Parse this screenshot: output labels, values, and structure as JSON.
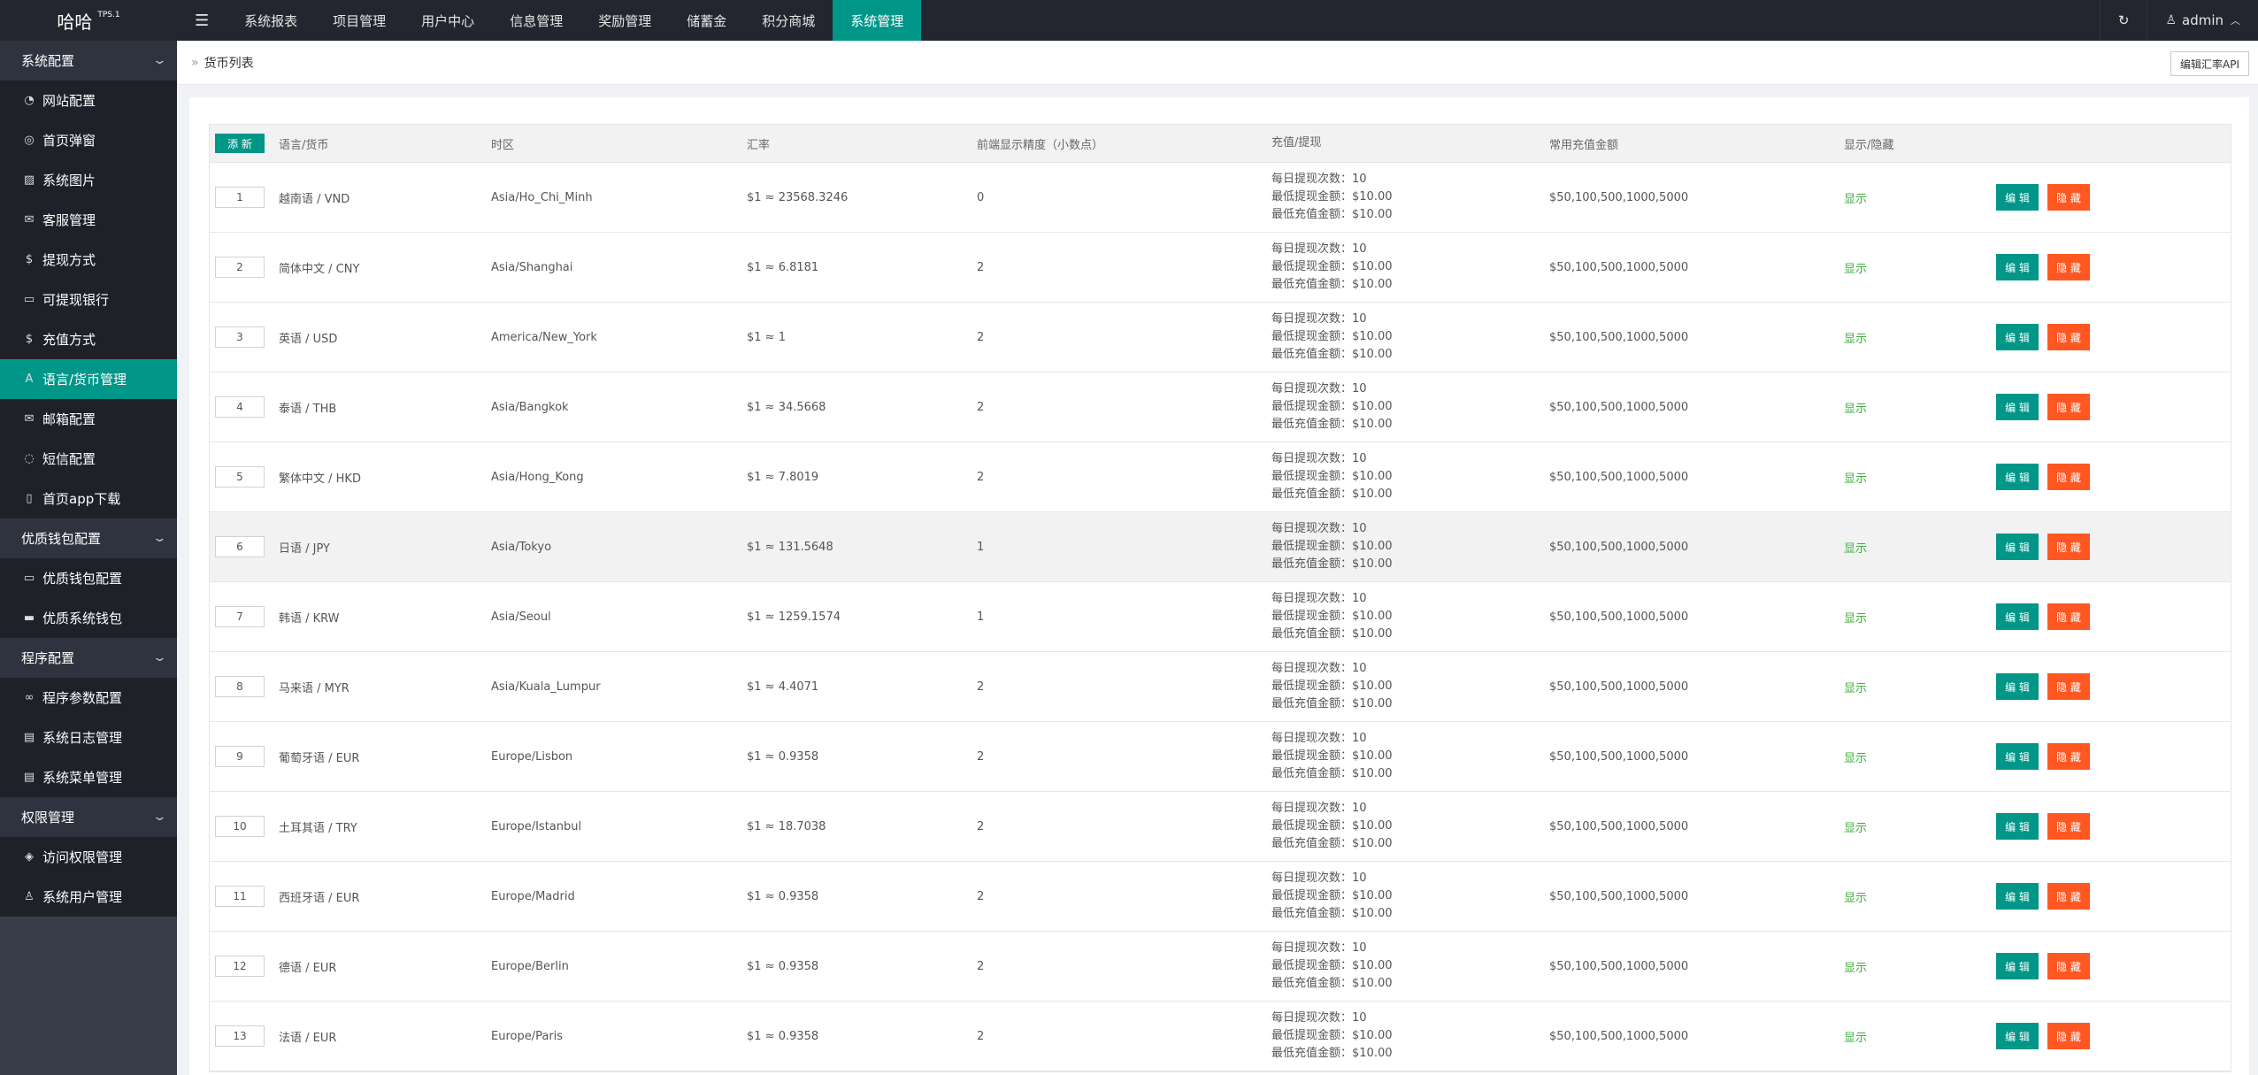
{
  "app": {
    "logo": "哈哈",
    "version": "TPS.1"
  },
  "topnav": {
    "menu_icon": "☰",
    "items": [
      "系统报表",
      "项目管理",
      "用户中心",
      "信息管理",
      "奖励管理",
      "储蓄金",
      "积分商城",
      "系统管理"
    ],
    "active_index": 7,
    "refresh_icon": "↻",
    "user": "admin"
  },
  "sidebar": [
    {
      "type": "group",
      "label": "系统配置"
    },
    {
      "type": "item",
      "icon": "◔",
      "label": "网站配置"
    },
    {
      "type": "item",
      "icon": "◎",
      "label": "首页弹窗"
    },
    {
      "type": "item",
      "icon": "▨",
      "label": "系统图片"
    },
    {
      "type": "item",
      "icon": "✉",
      "label": "客服管理"
    },
    {
      "type": "item",
      "icon": "$",
      "label": "提现方式"
    },
    {
      "type": "item",
      "icon": "▭",
      "label": "可提现银行"
    },
    {
      "type": "item",
      "icon": "$",
      "label": "充值方式"
    },
    {
      "type": "item",
      "icon": "A",
      "label": "语言/货币管理",
      "active": true
    },
    {
      "type": "item",
      "icon": "✉",
      "label": "邮箱配置"
    },
    {
      "type": "item",
      "icon": "◌",
      "label": "短信配置"
    },
    {
      "type": "item",
      "icon": "▯",
      "label": "首页app下载"
    },
    {
      "type": "group",
      "label": "优质钱包配置"
    },
    {
      "type": "item",
      "icon": "▭",
      "label": "优质钱包配置"
    },
    {
      "type": "item",
      "icon": "▬",
      "label": "优质系统钱包"
    },
    {
      "type": "group",
      "label": "程序配置"
    },
    {
      "type": "item",
      "icon": "∞",
      "label": "程序参数配置"
    },
    {
      "type": "item",
      "icon": "▤",
      "label": "系统日志管理"
    },
    {
      "type": "item",
      "icon": "▤",
      "label": "系统菜单管理"
    },
    {
      "type": "group",
      "label": "权限管理"
    },
    {
      "type": "item",
      "icon": "◈",
      "label": "访问权限管理"
    },
    {
      "type": "item",
      "icon": "♙",
      "label": "系统用户管理"
    }
  ],
  "breadcrumb": {
    "sep": "»",
    "title": "货币列表"
  },
  "api_button": "编辑汇率API",
  "table": {
    "new_button": "添 新",
    "headers": [
      "语言/货币",
      "时区",
      "汇率",
      "前端显示精度（小数点）",
      "充值/提现",
      "常用充值金额",
      "显示/隐藏"
    ],
    "edit_label": "编 辑",
    "hide_label": "隐 藏",
    "rows": [
      {
        "no": "1",
        "lang": "越南语 / VND",
        "tz": "Asia/Ho_Chi_Minh",
        "rate": "$1 ≈ 23568.3246",
        "precision": "0",
        "limits": [
          "每日提现次数：10",
          "最低提现金额：$10.00",
          "最低充值金额：$10.00"
        ],
        "amounts": "$50,100,500,1000,5000",
        "status": "显示"
      },
      {
        "no": "2",
        "lang": "简体中文 / CNY",
        "tz": "Asia/Shanghai",
        "rate": "$1 ≈ 6.8181",
        "precision": "2",
        "limits": [
          "每日提现次数：10",
          "最低提现金额：$10.00",
          "最低充值金额：$10.00"
        ],
        "amounts": "$50,100,500,1000,5000",
        "status": "显示"
      },
      {
        "no": "3",
        "lang": "英语 / USD",
        "tz": "America/New_York",
        "rate": "$1 ≈ 1",
        "precision": "2",
        "limits": [
          "每日提现次数：10",
          "最低提现金额：$10.00",
          "最低充值金额：$10.00"
        ],
        "amounts": "$50,100,500,1000,5000",
        "status": "显示"
      },
      {
        "no": "4",
        "lang": "泰语 / THB",
        "tz": "Asia/Bangkok",
        "rate": "$1 ≈ 34.5668",
        "precision": "2",
        "limits": [
          "每日提现次数：10",
          "最低提现金额：$10.00",
          "最低充值金额：$10.00"
        ],
        "amounts": "$50,100,500,1000,5000",
        "status": "显示"
      },
      {
        "no": "5",
        "lang": "繁体中文 / HKD",
        "tz": "Asia/Hong_Kong",
        "rate": "$1 ≈ 7.8019",
        "precision": "2",
        "limits": [
          "每日提现次数：10",
          "最低提现金额：$10.00",
          "最低充值金额：$10.00"
        ],
        "amounts": "$50,100,500,1000,5000",
        "status": "显示"
      },
      {
        "no": "6",
        "lang": "日语 / JPY",
        "tz": "Asia/Tokyo",
        "rate": "$1 ≈ 131.5648",
        "precision": "1",
        "limits": [
          "每日提现次数：10",
          "最低提现金额：$10.00",
          "最低充值金额：$10.00"
        ],
        "amounts": "$50,100,500,1000,5000",
        "status": "显示",
        "hover": true
      },
      {
        "no": "7",
        "lang": "韩语 / KRW",
        "tz": "Asia/Seoul",
        "rate": "$1 ≈ 1259.1574",
        "precision": "1",
        "limits": [
          "每日提现次数：10",
          "最低提现金额：$10.00",
          "最低充值金额：$10.00"
        ],
        "amounts": "$50,100,500,1000,5000",
        "status": "显示"
      },
      {
        "no": "8",
        "lang": "马来语 / MYR",
        "tz": "Asia/Kuala_Lumpur",
        "rate": "$1 ≈ 4.4071",
        "precision": "2",
        "limits": [
          "每日提现次数：10",
          "最低提现金额：$10.00",
          "最低充值金额：$10.00"
        ],
        "amounts": "$50,100,500,1000,5000",
        "status": "显示"
      },
      {
        "no": "9",
        "lang": "葡萄牙语 / EUR",
        "tz": "Europe/Lisbon",
        "rate": "$1 ≈ 0.9358",
        "precision": "2",
        "limits": [
          "每日提现次数：10",
          "最低提现金额：$10.00",
          "最低充值金额：$10.00"
        ],
        "amounts": "$50,100,500,1000,5000",
        "status": "显示"
      },
      {
        "no": "10",
        "lang": "土耳其语 / TRY",
        "tz": "Europe/Istanbul",
        "rate": "$1 ≈ 18.7038",
        "precision": "2",
        "limits": [
          "每日提现次数：10",
          "最低提现金额：$10.00",
          "最低充值金额：$10.00"
        ],
        "amounts": "$50,100,500,1000,5000",
        "status": "显示"
      },
      {
        "no": "11",
        "lang": "西班牙语 / EUR",
        "tz": "Europe/Madrid",
        "rate": "$1 ≈ 0.9358",
        "precision": "2",
        "limits": [
          "每日提现次数：10",
          "最低提现金额：$10.00",
          "最低充值金额：$10.00"
        ],
        "amounts": "$50,100,500,1000,5000",
        "status": "显示"
      },
      {
        "no": "12",
        "lang": "德语 / EUR",
        "tz": "Europe/Berlin",
        "rate": "$1 ≈ 0.9358",
        "precision": "2",
        "limits": [
          "每日提现次数：10",
          "最低提现金额：$10.00",
          "最低充值金额：$10.00"
        ],
        "amounts": "$50,100,500,1000,5000",
        "status": "显示"
      },
      {
        "no": "13",
        "lang": "法语 / EUR",
        "tz": "Europe/Paris",
        "rate": "$1 ≈ 0.9358",
        "precision": "2",
        "limits": [
          "每日提现次数：10",
          "最低提现金额：$10.00",
          "最低充值金额：$10.00"
        ],
        "amounts": "$50,100,500,1000,5000",
        "status": "显示"
      }
    ]
  }
}
